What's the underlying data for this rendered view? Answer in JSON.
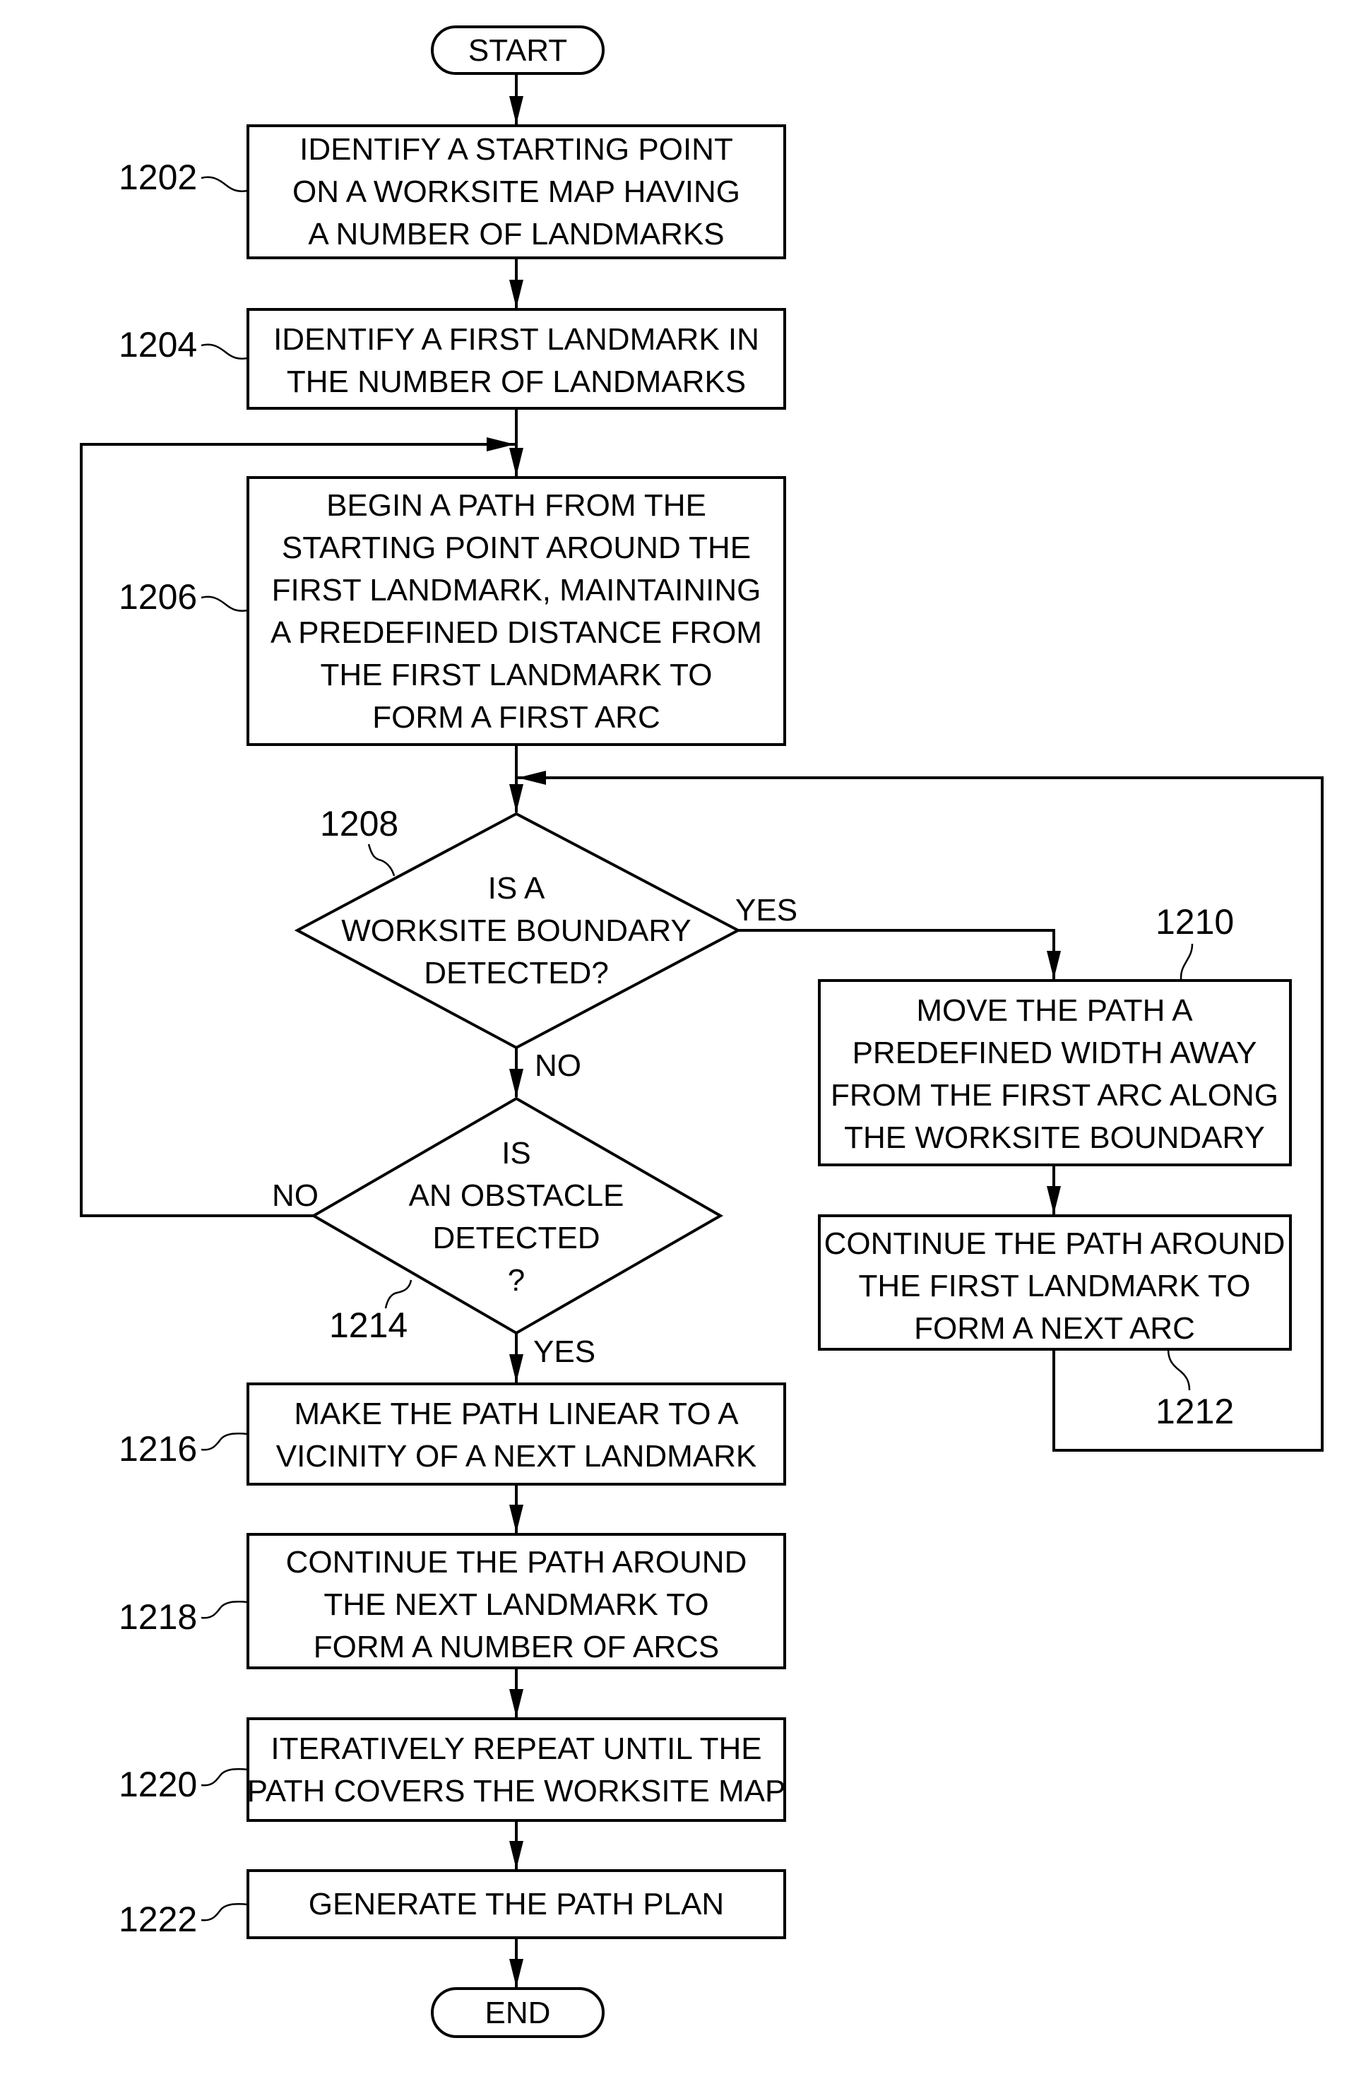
{
  "figure": {
    "start_label": "START",
    "end_label": "END",
    "steps": {
      "s1202": {
        "ref": "1202",
        "lines": [
          "IDENTIFY A STARTING POINT",
          "ON A WORKSITE MAP HAVING",
          "A NUMBER OF LANDMARKS"
        ]
      },
      "s1204": {
        "ref": "1204",
        "lines": [
          "IDENTIFY A FIRST LANDMARK IN",
          "THE NUMBER OF LANDMARKS"
        ]
      },
      "s1206": {
        "ref": "1206",
        "lines": [
          "BEGIN A PATH FROM THE",
          "STARTING POINT AROUND THE",
          "FIRST LANDMARK, MAINTAINING",
          "A PREDEFINED DISTANCE FROM",
          "THE FIRST LANDMARK TO",
          "FORM A FIRST ARC"
        ]
      },
      "s1208": {
        "ref": "1208",
        "lines": [
          "IS A",
          "WORKSITE BOUNDARY",
          "DETECTED?"
        ]
      },
      "s1210": {
        "ref": "1210",
        "lines": [
          "MOVE THE PATH A",
          "PREDEFINED WIDTH AWAY",
          "FROM THE FIRST ARC ALONG",
          "THE WORKSITE BOUNDARY"
        ]
      },
      "s1212": {
        "ref": "1212",
        "lines": [
          "CONTINUE THE PATH AROUND",
          "THE FIRST LANDMARK TO",
          "FORM A NEXT ARC"
        ]
      },
      "s1214": {
        "ref": "1214",
        "lines": [
          "IS",
          "AN OBSTACLE",
          "DETECTED",
          "?"
        ]
      },
      "s1216": {
        "ref": "1216",
        "lines": [
          "MAKE THE PATH LINEAR TO A",
          "VICINITY OF A NEXT LANDMARK"
        ]
      },
      "s1218": {
        "ref": "1218",
        "lines": [
          "CONTINUE THE PATH AROUND",
          "THE NEXT LANDMARK TO",
          "FORM A NUMBER OF ARCS"
        ]
      },
      "s1220": {
        "ref": "1220",
        "lines": [
          "ITERATIVELY REPEAT UNTIL THE",
          "PATH COVERS THE WORKSITE MAP"
        ]
      },
      "s1222": {
        "ref": "1222",
        "lines": [
          "GENERATE THE PATH PLAN"
        ]
      }
    },
    "branch_labels": {
      "d1208_yes": "YES",
      "d1208_no": "NO",
      "d1214_no": "NO",
      "d1214_yes": "YES"
    }
  }
}
